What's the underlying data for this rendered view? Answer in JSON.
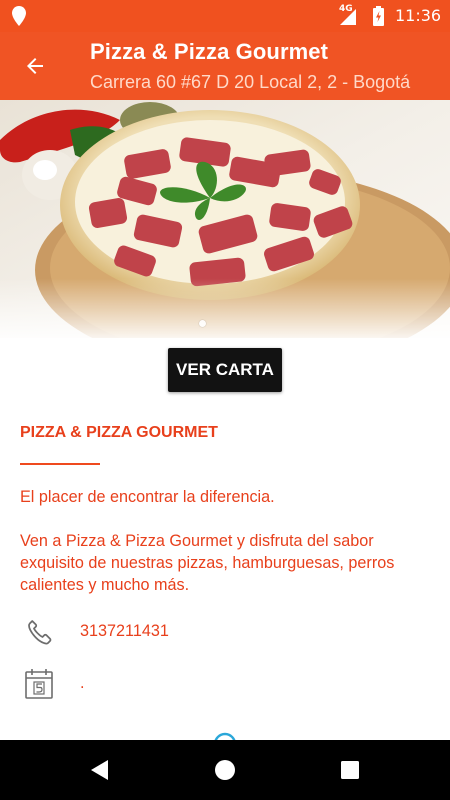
{
  "status_bar": {
    "network": "4G",
    "time": "11:36"
  },
  "app_bar": {
    "title": "Pizza & Pizza Gourmet",
    "subtitle": "Carrera 60  #67 D 20 Local 2, 2 - Bogotá"
  },
  "hero": {
    "carousel_pages": 1,
    "active_page": 1
  },
  "actions": {
    "menu_button_label": "VER CARTA"
  },
  "business": {
    "name": "PIZZA & PIZZA GOURMET",
    "tagline": "El placer de encontrar la diferencia.",
    "description": "Ven a Pizza & Pizza Gourmet y disfruta del sabor exquisito de nuestras pizzas, hamburguesas, perros calientes y mucho más.",
    "phone": "3137211431",
    "schedule": "."
  },
  "colors": {
    "primary": "#f05424",
    "status_bar": "#f0511f",
    "accent_text": "#e8401c",
    "button": "#121212",
    "nav_bar": "#000000"
  },
  "icons": {
    "status_pin": "location-pin-icon",
    "back": "arrow-back-icon",
    "phone": "phone-icon",
    "schedule": "calendar-icon"
  }
}
